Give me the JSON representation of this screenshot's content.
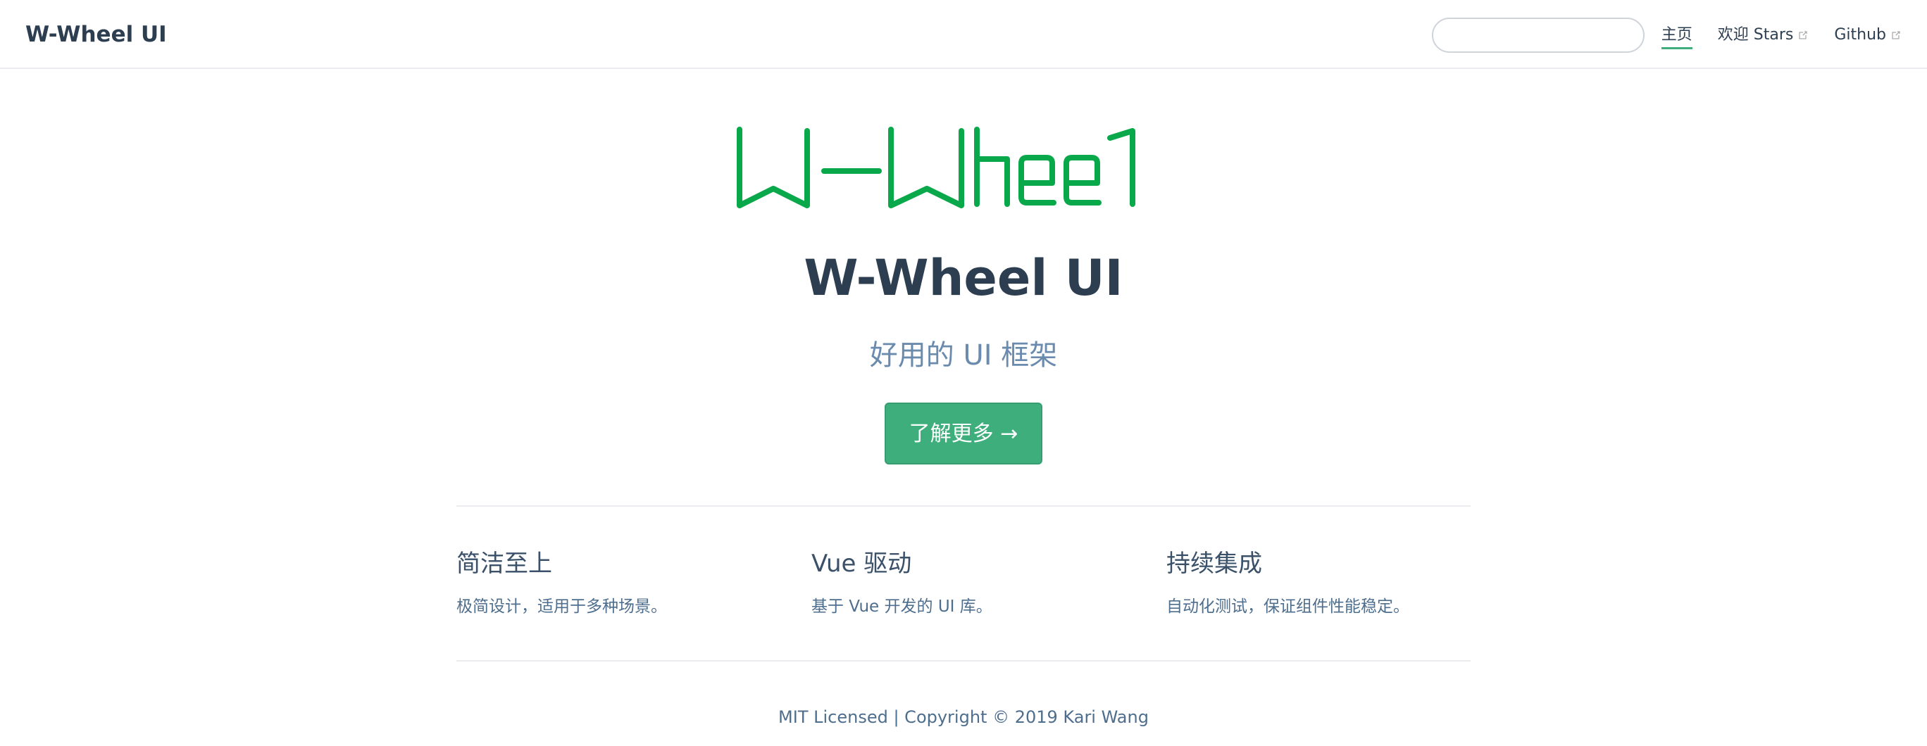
{
  "navbar": {
    "site_name": "W-Wheel UI",
    "search": {
      "value": "",
      "placeholder": ""
    },
    "items": [
      {
        "label": "主页",
        "active": true,
        "external": false
      },
      {
        "label": "欢迎 Stars",
        "active": false,
        "external": true,
        "icon": "external-link-icon"
      },
      {
        "label": "Github",
        "active": false,
        "external": true,
        "icon": "external-link-icon"
      }
    ]
  },
  "hero": {
    "logo_text": "W-Wheel",
    "title": "W-Wheel UI",
    "description": "好用的 UI 框架",
    "action_label": "了解更多 →"
  },
  "features": [
    {
      "title": "简洁至上",
      "details": "极简设计，适用于多种场景。"
    },
    {
      "title": "Vue 驱动",
      "details": "基于 Vue 开发的 UI 库。"
    },
    {
      "title": "持续集成",
      "details": "自动化测试，保证组件性能稳定。"
    }
  ],
  "footer": {
    "text": "MIT Licensed | Copyright © 2019 Kari Wang"
  },
  "colors": {
    "accent": "#3eaf7c",
    "logo_green": "#09a84a",
    "text": "#2c3e50",
    "muted": "#6a8bad"
  }
}
